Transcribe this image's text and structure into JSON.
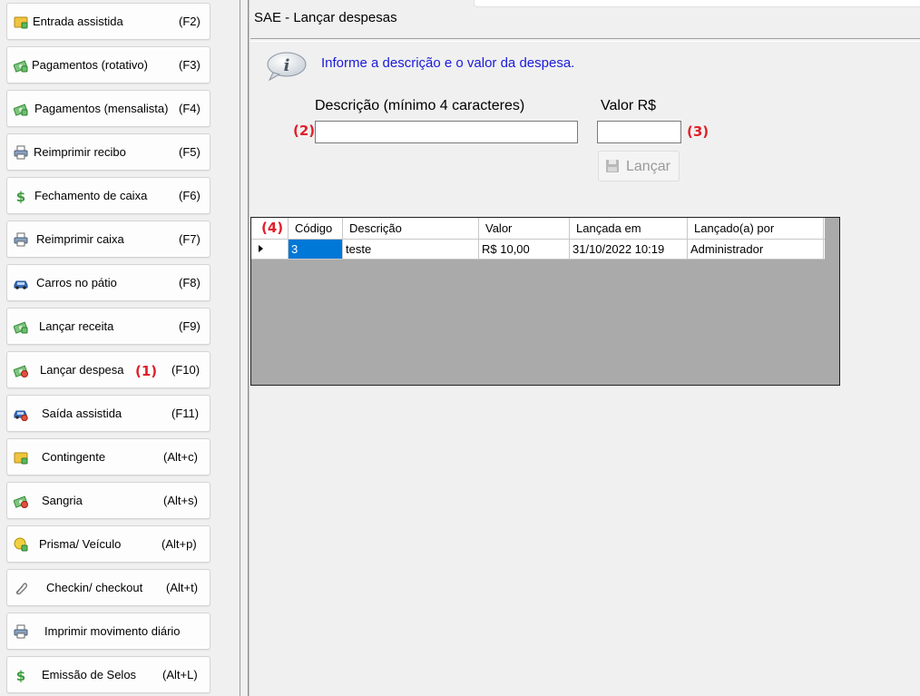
{
  "sidebar": {
    "items": [
      {
        "label": "Entrada assistida",
        "key": "(F2)",
        "icon": "ticket-icon"
      },
      {
        "label": "Pagamentos (rotativo)",
        "key": "(F3)",
        "icon": "money-icon"
      },
      {
        "label": "Pagamentos (mensalista)",
        "key": "(F4)",
        "icon": "money-icon"
      },
      {
        "label": "Reimprimir recibo",
        "key": "(F5)",
        "icon": "printer-icon"
      },
      {
        "label": "Fechamento de caixa",
        "key": "(F6)",
        "icon": "dollar-icon"
      },
      {
        "label": "Reimprimir caixa",
        "key": "(F7)",
        "icon": "printer-icon"
      },
      {
        "label": "Carros no pátio",
        "key": "(F8)",
        "icon": "car-icon"
      },
      {
        "label": "Lançar receita",
        "key": "(F9)",
        "icon": "money-icon"
      },
      {
        "label": "Lançar despesa",
        "key": "(F10)",
        "icon": "money-minus-icon",
        "annotation": "(1)"
      },
      {
        "label": "Saída assistida",
        "key": "(F11)",
        "icon": "car-exit-icon"
      },
      {
        "label": "Contingente",
        "key": "(Alt+c)",
        "icon": "ticket-icon"
      },
      {
        "label": "Sangria",
        "key": "(Alt+s)",
        "icon": "money-minus-icon"
      },
      {
        "label": "Prisma/ Veículo",
        "key": "(Alt+p)",
        "icon": "prism-icon"
      },
      {
        "label": "Checkin/ checkout",
        "key": "(Alt+t)",
        "icon": "paperclip-icon"
      },
      {
        "label": "Imprimir movimento diário",
        "key": "",
        "icon": "printer-icon"
      },
      {
        "label": "Emissão de Selos",
        "key": "(Alt+L)",
        "icon": "dollar-icon"
      }
    ]
  },
  "main": {
    "title": "SAE - Lançar despesas",
    "info_text": "Informe a descrição e o valor da despesa.",
    "description_label": "Descrição (mínimo 4 caracteres)",
    "description_value": "",
    "value_label": "Valor R$",
    "value_value": "",
    "launch_label": "Lançar",
    "annotations": {
      "description": "(2)",
      "value": "(3)",
      "grid": "(4)"
    }
  },
  "grid": {
    "columns": [
      "Código",
      "Descrição",
      "Valor",
      "Lançada em",
      "Lançado(a) por"
    ],
    "rows": [
      [
        "3",
        "teste",
        "R$ 10,00",
        "31/10/2022 10:19",
        "Administrador"
      ]
    ]
  },
  "colors": {
    "accent": "#0078d7",
    "annotation": "#e0202a",
    "info_text": "#1a1adc",
    "grid_background": "#aaaaaa"
  }
}
